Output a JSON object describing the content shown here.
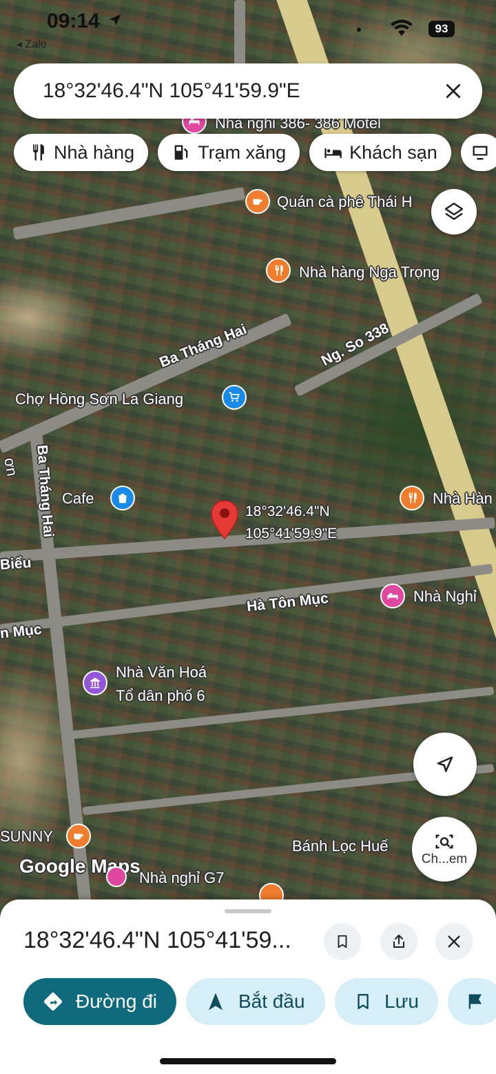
{
  "status_bar": {
    "time": "09:14",
    "back_app": "◂ Zalo",
    "battery": "93"
  },
  "search": {
    "query": "18°32'46.4\"N 105°41'59.9\"E"
  },
  "chips": [
    {
      "label": "Nhà hàng",
      "icon": "restaurant-icon"
    },
    {
      "label": "Trạm xăng",
      "icon": "gas-station-icon"
    },
    {
      "label": "Khách sạn",
      "icon": "hotel-icon"
    }
  ],
  "map": {
    "pois": {
      "motel": "Nhà nghỉ 386- 386 Motel",
      "cafe_thai": "Quán cà phê Thái H",
      "nha_hang_nga_trong": "Nhà hàng Nga Trọng",
      "cho_hong_son": "Chợ Hồng Sơn La Giang",
      "cafe": "Cafe",
      "nha_han": "Nhà Hàn",
      "nha_nghi_right": "Nhà Nghỉ",
      "nha_van_hoa_1": "Nhà Văn Hoá",
      "nha_van_hoa_2": "Tổ dân phố 6",
      "sunny": "SUNNY",
      "banh_loc_hue": "Bánh Lọc Huế",
      "nha_nghi_g7": "Nhà nghỉ G7"
    },
    "roads": {
      "ba_thang_hai_1": "Ba Tháng Hai",
      "ba_thang_hai_2": "Ba Tháng Hai",
      "ng_so_338": "Ng. So 338",
      "ha_ton_muc": "Hà Tôn Mục",
      "ha_ton_muc_left": "n Mục",
      "bieu": "Biểu",
      "left_partial": "ơn"
    },
    "pin_label_lat": "18°32'46.4\"N",
    "pin_label_lng": "105°41'59.9\"E",
    "watermark": "Google Maps",
    "lens_label": "Ch...em"
  },
  "sheet": {
    "title": "18°32'46.4\"N 105°41'59...",
    "actions": [
      {
        "label": "Đường đi",
        "icon": "directions-icon"
      },
      {
        "label": "Bắt đầu",
        "icon": "navigation-arrow-icon"
      },
      {
        "label": "Lưu",
        "icon": "bookmark-icon"
      }
    ]
  },
  "colors": {
    "primary_action": "#0f6a7d",
    "secondary_action": "#d6eef8",
    "pin_red": "#e53935"
  }
}
